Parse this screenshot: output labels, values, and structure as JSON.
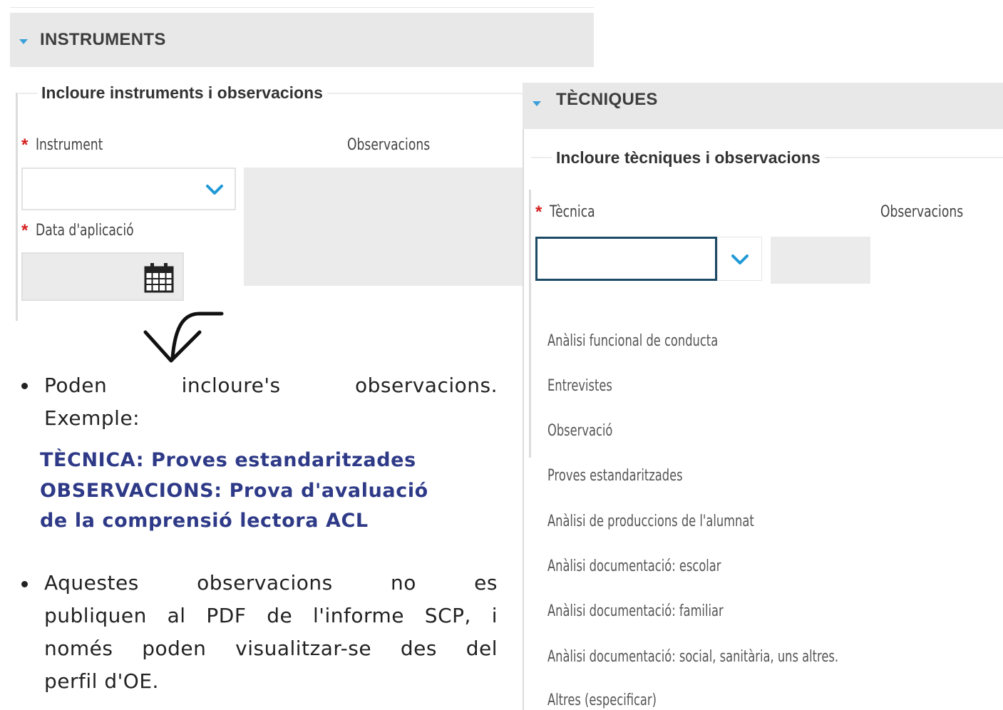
{
  "instruments_panel": {
    "header_title": "INSTRUMENTS",
    "legend": "Incloure instruments i observacions",
    "required_mark": "*",
    "instrument_label": "Instrument",
    "observations_label": "Observacions",
    "date_label": "Data d'aplicació",
    "instrument_value": "",
    "date_value": ""
  },
  "techniques_panel": {
    "header_title": "TÈCNIQUES",
    "legend": "Incloure tècniques i observacions",
    "required_mark": "*",
    "technique_label": "Tècnica",
    "observations_label": "Observacions",
    "technique_value": "",
    "options": [
      "Anàlisi funcional de conducta",
      "Entrevistes",
      "Observació",
      "Proves estandaritzades",
      "Anàlisi de produccions de l'alumnat",
      "Anàlisi documentació: escolar",
      "Anàlisi documentació: familiar",
      "Anàlisi documentació: social, sanitària, uns altres.",
      "Altres (especificar)"
    ]
  },
  "notes": {
    "bullet1_line1": "Poden incloure's observacions.",
    "bullet1_line2": "Exemple:",
    "example_line1": "TÈCNICA: Proves estandaritzades",
    "example_line2": "OBSERVACIONS:  Prova  d'avaluació",
    "example_line3": "de la comprensió lectora ACL",
    "bullet2_lines": [
      "Aquestes observacions no es",
      "publiquen al PDF de l'informe SCP, i",
      "només poden visualitzar-se des del",
      "perfil d'OE."
    ]
  },
  "colors": {
    "accent_blue": "#3b9fd9",
    "required_red": "#d61f1f",
    "example_navy": "#2e3a87",
    "header_grey": "#e8e8e8"
  },
  "icons": [
    "chevron-down-icon",
    "calendar-icon",
    "curved-arrow-icon"
  ]
}
